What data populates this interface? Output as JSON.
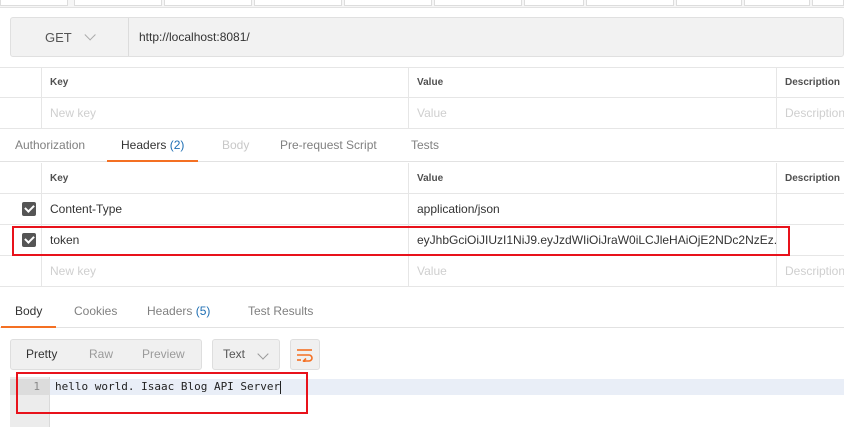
{
  "request": {
    "method": "GET",
    "url": "http://localhost:8081/"
  },
  "params_table": {
    "columns": [
      "Key",
      "Value",
      "Description"
    ],
    "new_key_placeholder": "New key",
    "new_value_placeholder": "Value",
    "new_desc_placeholder": "Description"
  },
  "request_tabs": [
    {
      "label": "Authorization"
    },
    {
      "label": "Headers",
      "count": "(2)"
    },
    {
      "label": "Body"
    },
    {
      "label": "Pre-request Script"
    },
    {
      "label": "Tests"
    }
  ],
  "headers_table": {
    "columns": [
      "Key",
      "Value",
      "Description"
    ],
    "rows": [
      {
        "key": "Content-Type",
        "value": "application/json",
        "checked": true
      },
      {
        "key": "token",
        "value": "eyJhbGciOiJIUzI1NiJ9.eyJzdWIiOiJraW0iLCJleHAiOjE2NDc2NzEz...",
        "checked": true
      }
    ],
    "new_key_placeholder": "New key",
    "new_value_placeholder": "Value",
    "new_desc_placeholder": "Description"
  },
  "response_tabs": [
    {
      "label": "Body"
    },
    {
      "label": "Cookies"
    },
    {
      "label": "Headers",
      "count": "(5)"
    },
    {
      "label": "Test Results"
    }
  ],
  "format": {
    "options": [
      "Pretty",
      "Raw",
      "Preview"
    ],
    "selected": "Pretty",
    "type": "Text"
  },
  "response_body": {
    "line_number": "1",
    "line_text": "hello world. Isaac Blog API Server"
  },
  "colors": {
    "accent": "#f47023",
    "count": "#1f6fb4",
    "annotation": "#e8121b"
  }
}
